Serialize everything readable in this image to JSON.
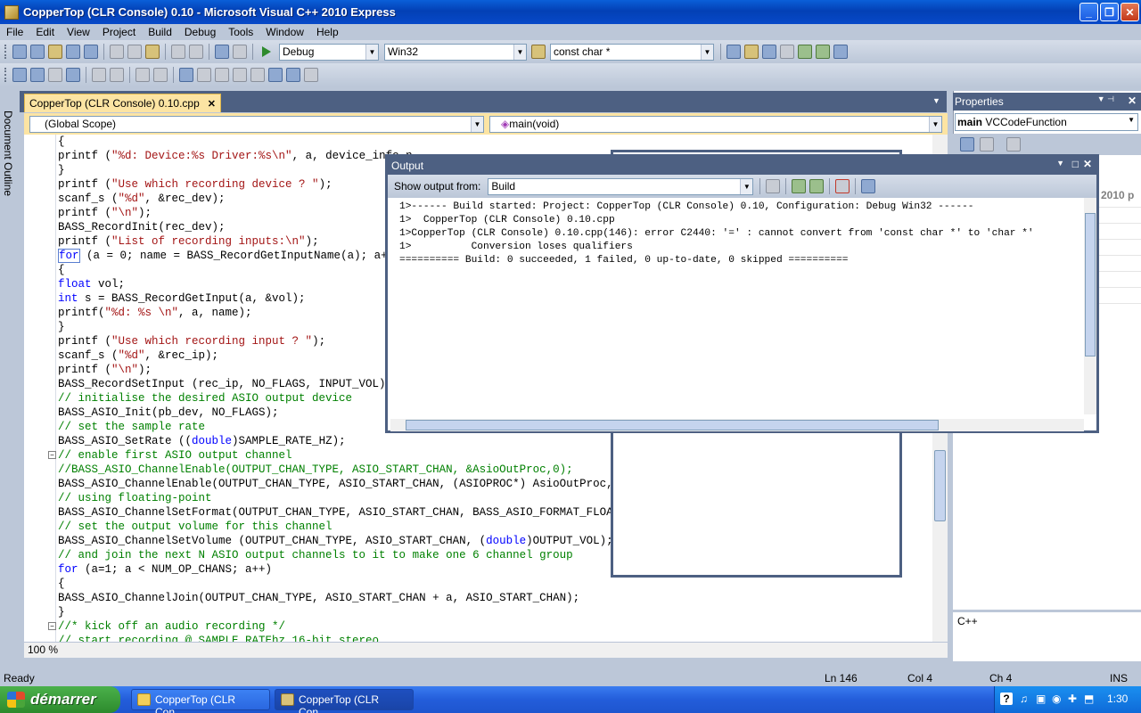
{
  "window": {
    "title": "CopperTop (CLR Console) 0.10 - Microsoft Visual C++ 2010 Express"
  },
  "menu": [
    "File",
    "Edit",
    "View",
    "Project",
    "Build",
    "Debug",
    "Tools",
    "Window",
    "Help"
  ],
  "toolbar": {
    "config": "Debug",
    "platform": "Win32",
    "find_value": "const char *"
  },
  "side_panel": {
    "label": "Document Outline"
  },
  "doc_tab": {
    "label": "CopperTop (CLR Console) 0.10.cpp"
  },
  "nav": {
    "scope": "(Global Scope)",
    "member": "main(void)"
  },
  "code": {
    "lines": [
      {
        "t": "{",
        "k": "n"
      },
      {
        "t": "printf (\"%d: Device:%s Driver:%s\\n\", a, device_info.n",
        "k": "s"
      },
      {
        "t": "}",
        "k": "n"
      },
      {
        "t": "printf (\"Use which recording device ? \");",
        "k": "s"
      },
      {
        "t": "scanf_s (\"%d\", &rec_dev);",
        "k": "s"
      },
      {
        "t": "printf (\"\\n\");",
        "k": "s"
      },
      {
        "t": "BASS_RecordInit(rec_dev);",
        "k": "n"
      },
      {
        "t": "printf (\"List of recording inputs:\\n\");",
        "k": "s"
      },
      {
        "t": "for (a = 0; name = BASS_RecordGetInputName(a); a++)",
        "k": "for"
      },
      {
        "t": "{",
        "k": "n"
      },
      {
        "t": "float vol;",
        "k": "float"
      },
      {
        "t": "int s = BASS_RecordGetInput(a, &vol);",
        "k": "int"
      },
      {
        "t": "printf(\"%d: %s \\n\", a, name);",
        "k": "s"
      },
      {
        "t": "}",
        "k": "n"
      },
      {
        "t": "printf (\"Use which recording input ? \");",
        "k": "s"
      },
      {
        "t": "scanf_s (\"%d\", &rec_ip);",
        "k": "s"
      },
      {
        "t": "printf (\"\\n\");",
        "k": "s"
      },
      {
        "t": "BASS_RecordSetInput (rec_ip, NO_FLAGS, INPUT_VOL);",
        "k": "n"
      },
      {
        "t": "// initialise the desired ASIO output device",
        "k": "c"
      },
      {
        "t": "BASS_ASIO_Init(pb_dev, NO_FLAGS);",
        "k": "n"
      },
      {
        "t": "// set the sample rate",
        "k": "c"
      },
      {
        "t": "BASS_ASIO_SetRate ((double)SAMPLE_RATE_HZ);",
        "k": "dbl"
      },
      {
        "t": "// enable first ASIO output channel",
        "k": "c"
      },
      {
        "t": "//BASS_ASIO_ChannelEnable(OUTPUT_CHAN_TYPE, ASIO_START_CHAN, &AsioOutProc,0);",
        "k": "c"
      },
      {
        "t": "BASS_ASIO_ChannelEnable(OUTPUT_CHAN_TYPE, ASIO_START_CHAN, (ASIOPROC*) AsioOutProc,0);",
        "k": "n"
      },
      {
        "t": "// using floating-point",
        "k": "c"
      },
      {
        "t": "BASS_ASIO_ChannelSetFormat(OUTPUT_CHAN_TYPE, ASIO_START_CHAN, BASS_ASIO_FORMAT_FLOAT);",
        "k": "n"
      },
      {
        "t": "// set the output volume for this channel",
        "k": "c"
      },
      {
        "t": "BASS_ASIO_ChannelSetVolume (OUTPUT_CHAN_TYPE, ASIO_START_CHAN, (double)OUTPUT_VOL);",
        "k": "dbl"
      },
      {
        "t": "// and join the next N ASIO output channels to it to make one 6 channel group",
        "k": "c"
      },
      {
        "t": "for (a=1; a < NUM_OP_CHANS; a++)",
        "k": "for"
      },
      {
        "t": "{",
        "k": "n"
      },
      {
        "t": "BASS_ASIO_ChannelJoin(OUTPUT_CHAN_TYPE, ASIO_START_CHAN + a, ASIO_START_CHAN);",
        "k": "n"
      },
      {
        "t": "}",
        "k": "n"
      },
      {
        "t": "//* kick off an audio recording */",
        "k": "c"
      },
      {
        "t": "// start recording @ SAMPLE_RATEhz 16-bit stereo",
        "k": "c"
      }
    ]
  },
  "zoom": "100 %",
  "output": {
    "title": "Output",
    "show_from_label": "Show output from:",
    "source": "Build",
    "lines": [
      "1>------ Build started: Project: CopperTop (CLR Console) 0.10, Configuration: Debug Win32 ------",
      "1>  CopperTop (CLR Console) 0.10.cpp",
      "1>CopperTop (CLR Console) 0.10.cpp(146): error C2440: '=' : cannot convert from 'const char *' to 'char *'",
      "1>          Conversion loses qualifiers",
      "========== Build: 0 succeeded, 1 failed, 0 up-to-date, 0 skipped =========="
    ]
  },
  "properties": {
    "title": "Properties",
    "object_name": "main",
    "object_type": "VCCodeFunction",
    "partial_value": "2010 p",
    "description": "C++"
  },
  "status": {
    "ready": "Ready",
    "ln": "Ln 146",
    "col": "Col 4",
    "ch": "Ch 4",
    "ins": "INS"
  },
  "taskbar": {
    "start": "démarrer",
    "tasks": [
      "CopperTop (CLR Con...",
      "CopperTop (CLR Con..."
    ],
    "clock": "1:30",
    "help": "?"
  }
}
